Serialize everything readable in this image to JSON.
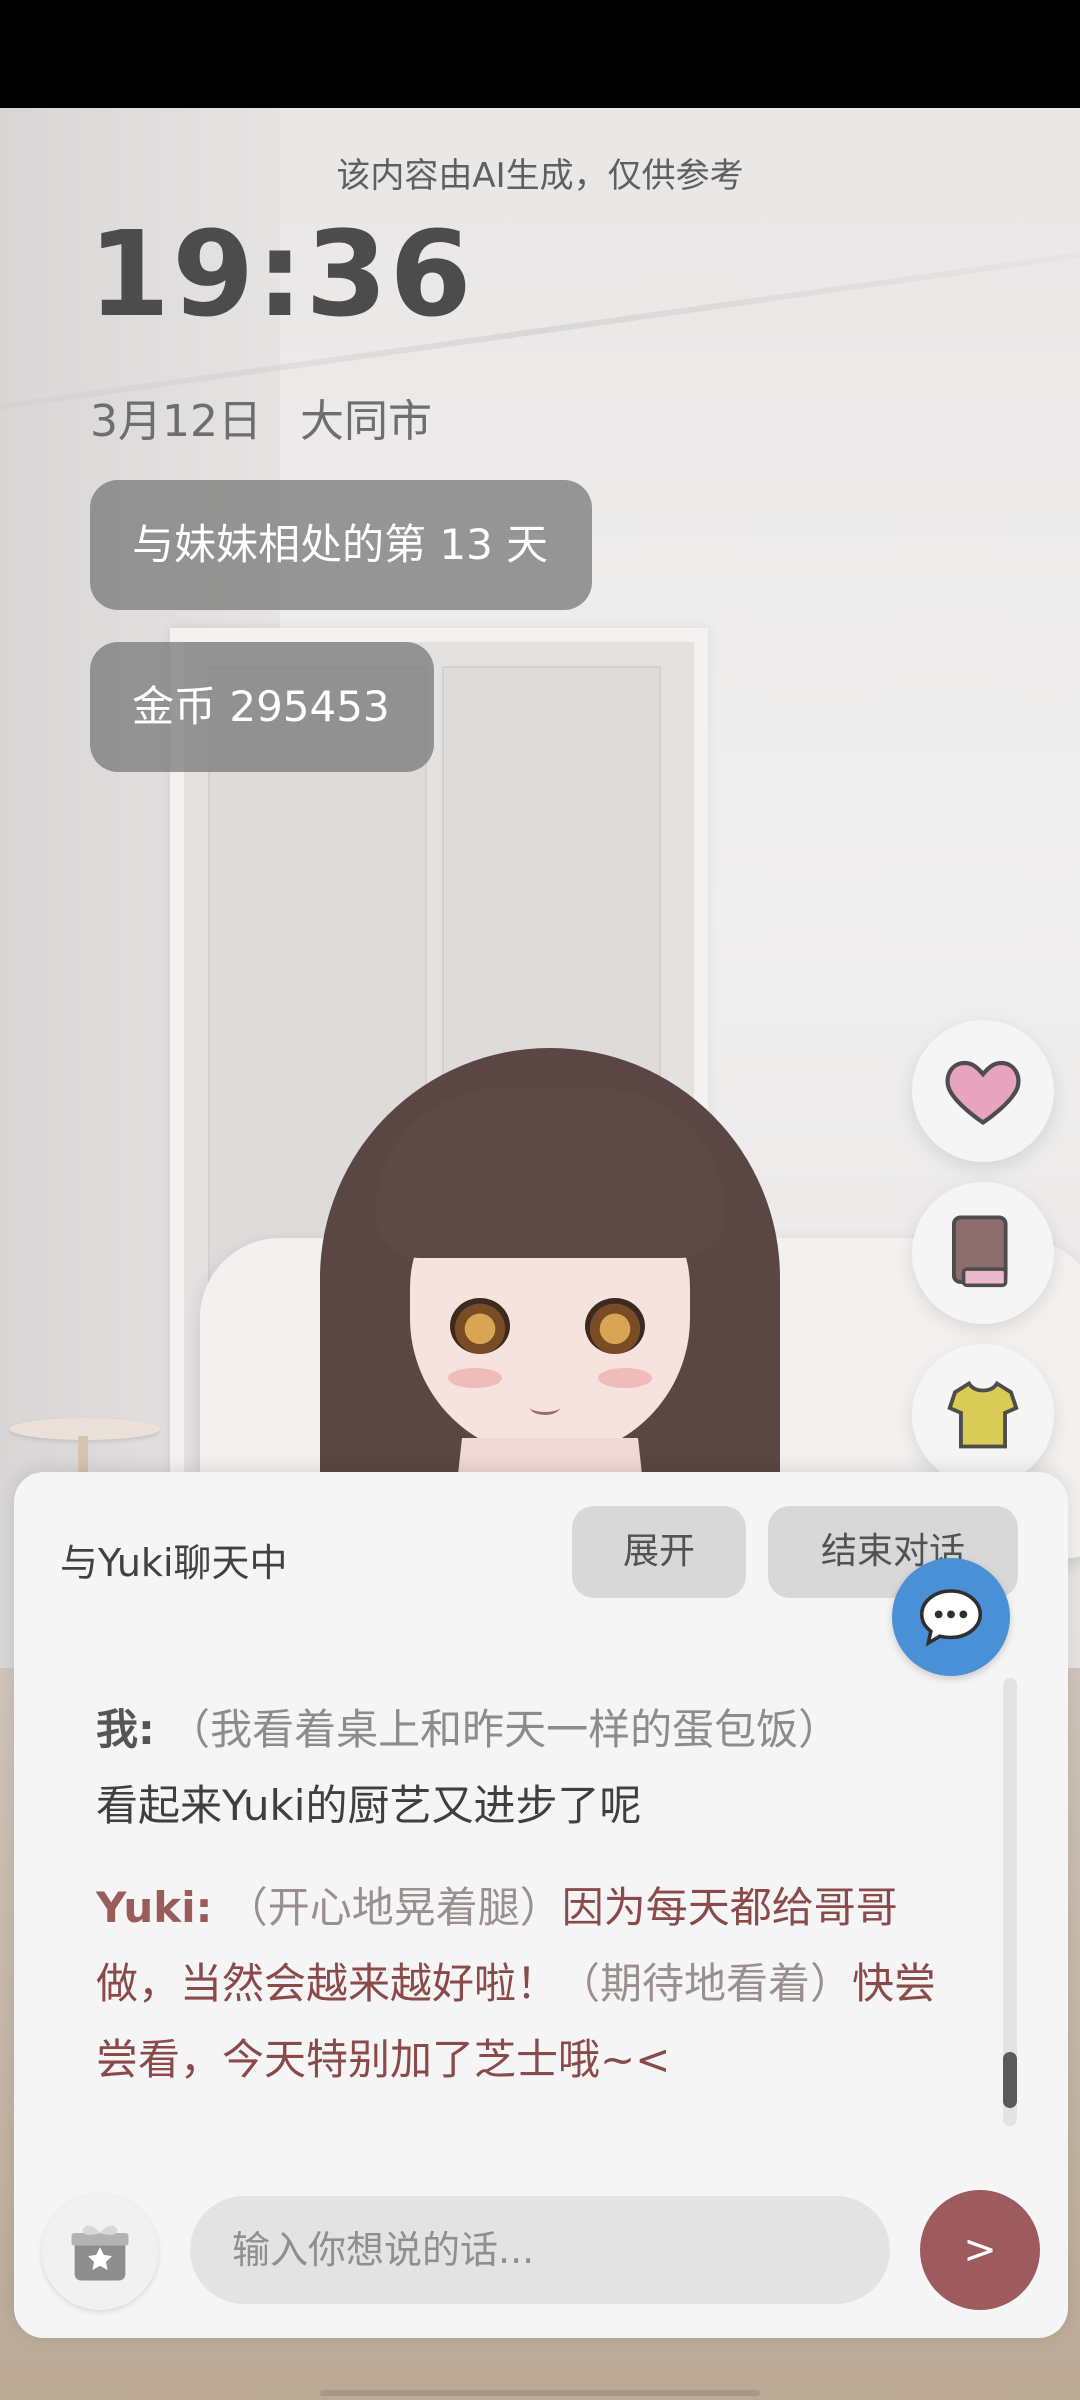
{
  "header": {
    "ai_notice": "该内容由AI生成，仅供参考",
    "time": "19:36",
    "date": "3月12日",
    "location": "大同市"
  },
  "stats": {
    "days_label": "与妹妹相处的第 13 天",
    "coins_label": "金币 295453"
  },
  "actions": {
    "icons": [
      "heart-icon",
      "book-icon",
      "shirt-icon"
    ]
  },
  "chat": {
    "title": "与Yuki聊天中",
    "expand_label": "展开",
    "end_label": "结束对话",
    "messages": [
      {
        "speaker": "我:",
        "action": "（我看着桌上和昨天一样的蛋包饭）",
        "text": "看起来Yuki的厨艺又进步了呢"
      },
      {
        "speaker": "Yuki:",
        "action1": "（开心地晃着腿）",
        "text1": "因为每天都给哥哥做，当然会越来越好啦！",
        "action2": "（期待地看着）",
        "text2": "快尝尝看，今天特别加了芝士哦~<"
      }
    ]
  },
  "input": {
    "placeholder": "输入你想说的话...",
    "send_label": ">"
  },
  "colors": {
    "accent_send": "#9e5b5d",
    "chat_bubble_blue": "#4a90d6"
  }
}
